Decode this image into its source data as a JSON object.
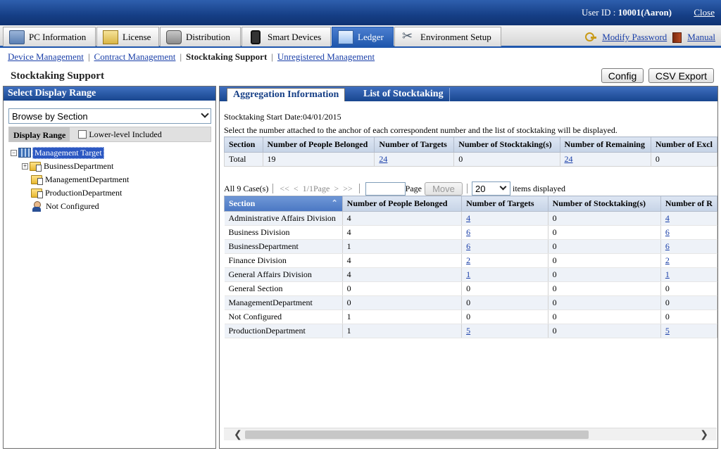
{
  "header": {
    "user_label": "User ID : ",
    "user_value": "10001(Aaron)",
    "close": "Close"
  },
  "main_tabs": [
    {
      "label": "PC Information",
      "icon": "pc-info-icon"
    },
    {
      "label": "License",
      "icon": "license-icon"
    },
    {
      "label": "Distribution",
      "icon": "distribution-icon"
    },
    {
      "label": "Smart Devices",
      "icon": "smart-device-icon"
    },
    {
      "label": "Ledger",
      "icon": "ledger-icon",
      "active": true
    },
    {
      "label": "Environment Setup",
      "icon": "tools-icon"
    }
  ],
  "top_links": {
    "modify_password": "Modify Password",
    "manual": "Manual"
  },
  "subnav": {
    "device_management": "Device Management",
    "contract_management": "Contract Management",
    "stocktaking_support": "Stocktaking Support",
    "unregistered_management": "Unregistered Management"
  },
  "page": {
    "title": "Stocktaking Support",
    "config": "Config",
    "csv_export": "CSV Export"
  },
  "left_panel": {
    "header": "Select Display Range",
    "browse_select": "Browse by Section",
    "display_range_label": "Display Range",
    "lower_level_label": "Lower-level Included",
    "tree": {
      "root": "Management Target",
      "children": [
        "BusinessDepartment",
        "ManagementDepartment",
        "ProductionDepartment",
        "Not Configured"
      ]
    }
  },
  "right_panel": {
    "tab_aggregation": "Aggregation Information",
    "tab_list": "List of Stocktaking",
    "start_date": "Stocktaking Start Date:04/01/2015",
    "instruction": "Select the number attached to the anchor of each correspondent number and the list of stocktaking will be displayed.",
    "agg_headers": [
      "Section",
      "Number of People Belonged",
      "Number of Targets",
      "Number of Stocktaking(s)",
      "Number of Remaining",
      "Number of Excl"
    ],
    "agg_row": [
      "Total",
      "19",
      "24",
      "0",
      "24",
      "0"
    ],
    "pager": {
      "count": "All 9 Case(s)",
      "first": "<<",
      "prev": "<",
      "page_of": "1/1Page",
      "next": ">",
      "last": ">>",
      "page_label": "Page",
      "move": "Move",
      "items_value": "20",
      "items_label": "items displayed"
    },
    "section_headers": [
      "Section",
      "Number of People Belonged",
      "Number of Targets",
      "Number of Stocktaking(s)",
      "Number of R"
    ],
    "section_rows": [
      {
        "section": "Administrative Affairs Division",
        "people": "4",
        "targets": "4",
        "stocktaking": "0",
        "remaining": "4",
        "link": true
      },
      {
        "section": "Business Division",
        "people": "4",
        "targets": "6",
        "stocktaking": "0",
        "remaining": "6",
        "link": true
      },
      {
        "section": "BusinessDepartment",
        "people": "1",
        "targets": "6",
        "stocktaking": "0",
        "remaining": "6",
        "link": true
      },
      {
        "section": "Finance Division",
        "people": "4",
        "targets": "2",
        "stocktaking": "0",
        "remaining": "2",
        "link": true
      },
      {
        "section": "General Affairs Division",
        "people": "4",
        "targets": "1",
        "stocktaking": "0",
        "remaining": "1",
        "link": true
      },
      {
        "section": "General Section",
        "people": "0",
        "targets": "0",
        "stocktaking": "0",
        "remaining": "0",
        "link": false
      },
      {
        "section": "ManagementDepartment",
        "people": "0",
        "targets": "0",
        "stocktaking": "0",
        "remaining": "0",
        "link": false
      },
      {
        "section": "Not Configured",
        "people": "1",
        "targets": "0",
        "stocktaking": "0",
        "remaining": "0",
        "link": false
      },
      {
        "section": "ProductionDepartment",
        "people": "1",
        "targets": "5",
        "stocktaking": "0",
        "remaining": "5",
        "link": true
      }
    ]
  },
  "colors": {
    "header_blue": "#163f86",
    "link_blue": "#1a3fa8",
    "row_alt": "#eef2f8"
  }
}
